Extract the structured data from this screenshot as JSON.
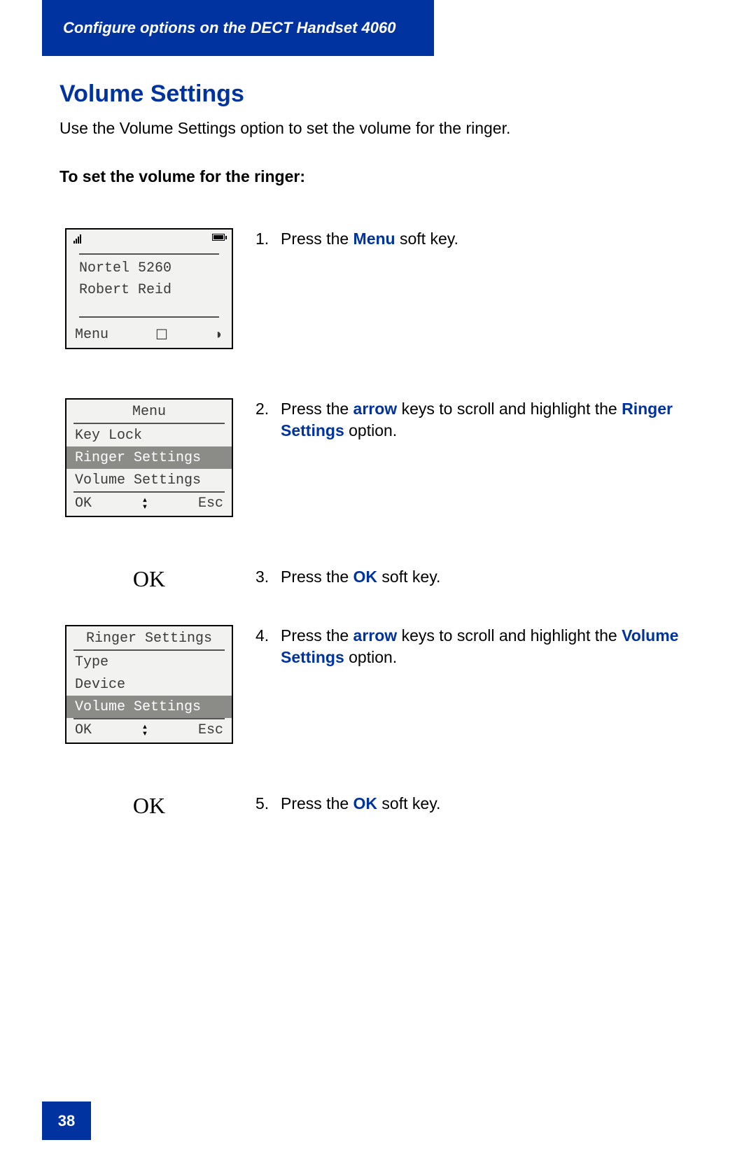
{
  "header": {
    "title": "Configure options on the DECT Handset 4060"
  },
  "section": {
    "title": "Volume Settings",
    "intro": "Use the Volume Settings option to set the volume for the ringer.",
    "subheader": "To set the volume for the ringer:"
  },
  "steps": [
    {
      "num": "1.",
      "pre": "Press the ",
      "key1": "Menu",
      "post": " soft key."
    },
    {
      "num": "2.",
      "pre": "Press the ",
      "key1": "arrow",
      "mid": " keys to scroll and highlight the ",
      "key2": "Ringer Settings",
      "post": " option."
    },
    {
      "num": "3.",
      "pre": "Press the ",
      "key1": "OK",
      "post": " soft key."
    },
    {
      "num": "4.",
      "pre": "Press the ",
      "key1": "arrow",
      "mid": " keys to scroll and highlight the ",
      "key2": "Volume Settings",
      "post": " option."
    },
    {
      "num": "5.",
      "pre": "Press the ",
      "key1": "OK",
      "post": " soft key."
    }
  ],
  "handset_home": {
    "line1": "Nortel 5260",
    "line2": "Robert Reid",
    "soft_left": "Menu"
  },
  "handset_menu": {
    "title": "Menu",
    "items": [
      "Key Lock",
      "Ringer Settings",
      "Volume Settings"
    ],
    "soft_left": "OK",
    "soft_right": "Esc"
  },
  "handset_ringer": {
    "title": "Ringer Settings",
    "items": [
      "Type",
      "Device",
      "Volume Settings"
    ],
    "soft_left": "OK",
    "soft_right": "Esc"
  },
  "ok_big": "OK",
  "page_number": "38"
}
